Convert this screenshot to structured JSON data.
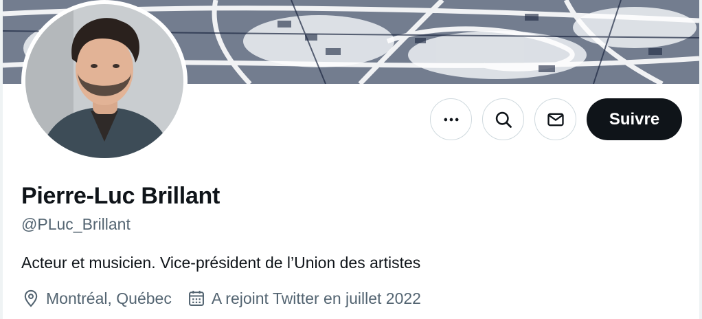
{
  "profile": {
    "display_name": "Pierre-Luc Brillant",
    "handle": "@PLuc_Brillant",
    "bio": "Acteur et musicien. Vice-président de l’Union des artistes",
    "location": "Montréal, Québec",
    "joined": "A rejoint Twitter en juillet 2022"
  },
  "actions": {
    "more_icon": "more-horizontal-icon",
    "search_icon": "search-icon",
    "message_icon": "envelope-icon",
    "follow_label": "Suivre"
  },
  "meta_icons": {
    "location_icon": "location-pin-icon",
    "calendar_icon": "calendar-icon"
  },
  "colors": {
    "primary_text": "#0f1419",
    "secondary_text": "#536471",
    "button_border": "#cfd9de",
    "follow_background": "#0f1419",
    "follow_text": "#ffffff"
  }
}
